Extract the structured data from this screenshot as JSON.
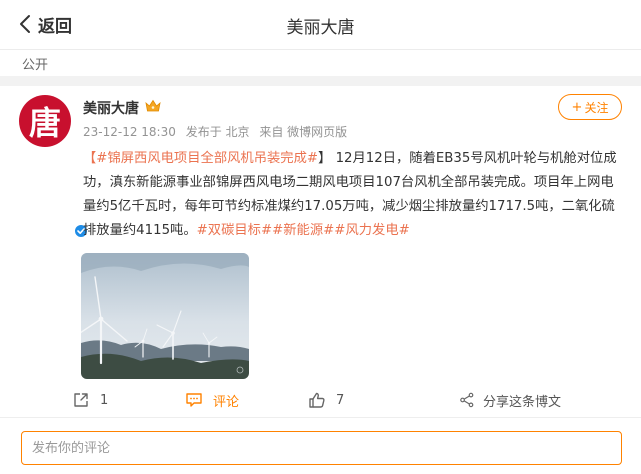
{
  "header": {
    "back_label": "返回",
    "title": "美丽大唐"
  },
  "visibility": "公开",
  "post": {
    "author": {
      "name": "美丽大唐",
      "avatar_char": "唐",
      "verified": true,
      "badge": "crown-icon"
    },
    "timestamp": "23-12-12 18:30",
    "location": "发布于 北京",
    "source": "来自 微博网页版",
    "follow_label": "关注",
    "text": {
      "topic_bracket_open": "【",
      "topic": "#锦屏西风电项目全部风机吊装完成#",
      "topic_bracket_close": "】",
      "body": "12月12日，随着EB35号风机叶轮与机舱对位成功，滇东新能源事业部锦屏西风电场二期风电项目107台风机全部吊装完成。项目年上网电量约5亿千瓦时，每年可节约标准煤约17.05万吨，减少烟尘排放量约1717.5吨，二氧化硫排放量约4115吨。",
      "tags": [
        "#双碳目标#",
        "#新能源#",
        "#风力发电#"
      ]
    }
  },
  "actions": {
    "repost": {
      "icon": "share-out-icon",
      "count": "1"
    },
    "comment": {
      "icon": "comment-icon",
      "label": "评论"
    },
    "like": {
      "icon": "thumbs-up-icon",
      "count": "7"
    },
    "share": {
      "icon": "share-icon",
      "label": "分享这条博文"
    }
  },
  "comment_box": {
    "placeholder": "发布你的评论"
  },
  "colors": {
    "accent": "#ff8200",
    "tag": "#eb7350",
    "avatar_bg": "#c8102e",
    "verify_blue": "#1e8ce6"
  }
}
